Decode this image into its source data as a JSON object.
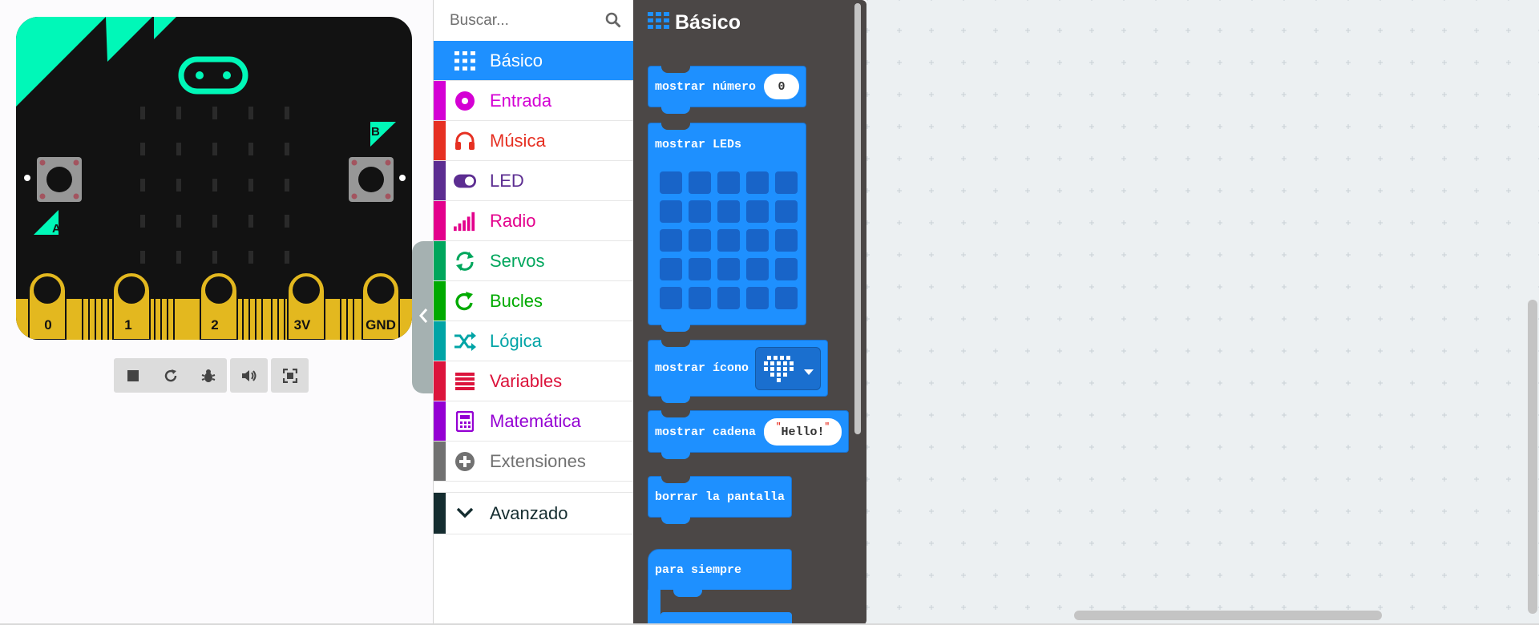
{
  "simulator": {
    "button_a_label": "A",
    "button_b_label": "B",
    "pins": [
      "0",
      "1",
      "2",
      "3V",
      "GND"
    ],
    "colors": {
      "board": "#121212",
      "accent": "#00f8b8",
      "gold": "#e3b81f"
    }
  },
  "sim_toolbar": {
    "buttons": [
      "stop-icon",
      "restart-icon",
      "debug-icon",
      "sound-icon",
      "fullscreen-icon"
    ]
  },
  "search": {
    "placeholder": "Buscar..."
  },
  "categories": [
    {
      "label": "Básico",
      "color": "#1e90ff",
      "icon": "grid-icon",
      "selected": true
    },
    {
      "label": "Entrada",
      "color": "#d400d4",
      "icon": "circle-target-icon"
    },
    {
      "label": "Música",
      "color": "#e63022",
      "icon": "headphones-icon"
    },
    {
      "label": "LED",
      "color": "#5c2d91",
      "icon": "toggle-icon"
    },
    {
      "label": "Radio",
      "color": "#e3008c",
      "icon": "signal-bars-icon"
    },
    {
      "label": "Servos",
      "color": "#00a65c",
      "icon": "refresh-icon"
    },
    {
      "label": "Bucles",
      "color": "#00aa00",
      "icon": "loop-icon"
    },
    {
      "label": "Lógica",
      "color": "#00a4a6",
      "icon": "shuffle-icon"
    },
    {
      "label": "Variables",
      "color": "#dc143c",
      "icon": "list-icon"
    },
    {
      "label": "Matemática",
      "color": "#9400d3",
      "icon": "calculator-icon"
    },
    {
      "label": "Extensiones",
      "color": "#717171",
      "icon": "plus-circle-icon"
    }
  ],
  "advanced": {
    "label": "Avanzado",
    "color": "#152d30",
    "icon": "chevron-down-icon"
  },
  "flyout": {
    "title": "Básico",
    "blocks": {
      "show_number": {
        "label": "mostrar número",
        "value": "0"
      },
      "show_leds": {
        "label": "mostrar LEDs"
      },
      "show_icon": {
        "label": "mostrar ícono",
        "icon": "heart-icon"
      },
      "show_string": {
        "label": "mostrar cadena",
        "value": "Hello!"
      },
      "clear_screen": {
        "label": "borrar la pantalla"
      },
      "forever": {
        "label": "para siempre"
      }
    }
  }
}
